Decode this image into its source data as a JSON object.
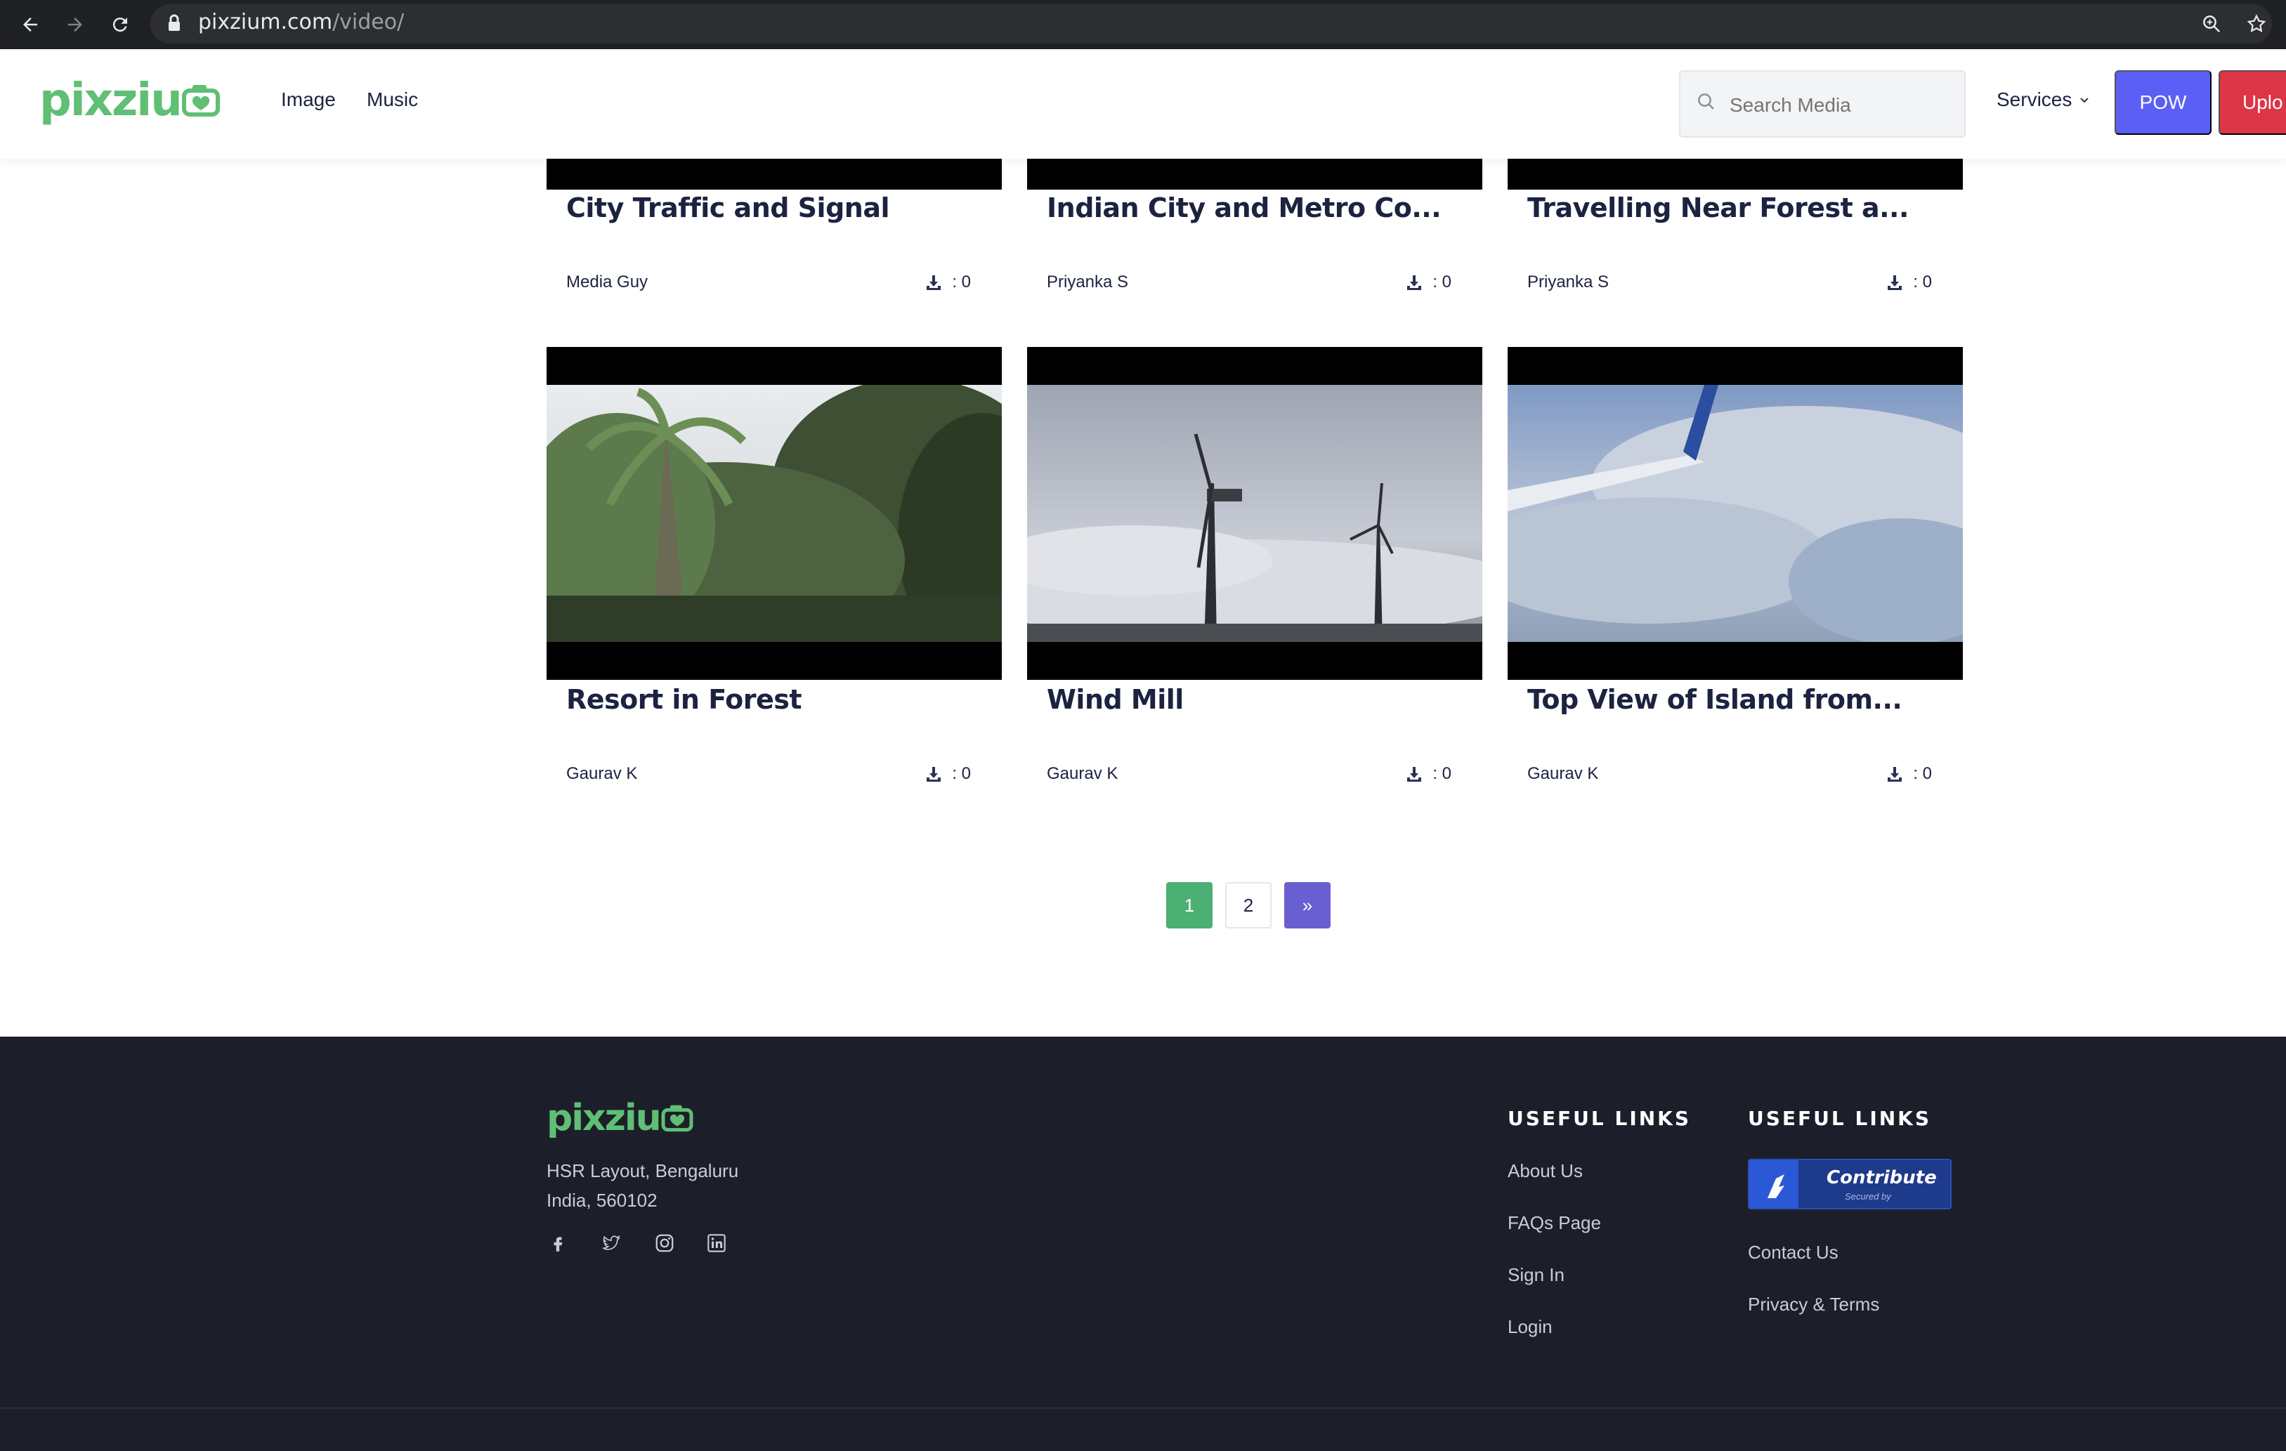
{
  "browser": {
    "url_domain": "pixzium.com",
    "url_path": "/video/"
  },
  "header": {
    "logo_text": "pixziu",
    "nav": [
      "Image",
      "Music"
    ],
    "search_placeholder": "Search Media",
    "services_label": "Services",
    "pow_label": "POW",
    "upload_label": "Uplo"
  },
  "cards": [
    {
      "title": "City Traffic and Signal",
      "author": "Media Guy",
      "downloads": ": 0"
    },
    {
      "title": "Indian City and Metro Co...",
      "author": "Priyanka S",
      "downloads": ": 0"
    },
    {
      "title": "Travelling Near Forest a...",
      "author": "Priyanka S",
      "downloads": ": 0"
    },
    {
      "title": "Resort in Forest",
      "author": "Gaurav K",
      "downloads": ": 0"
    },
    {
      "title": "Wind Mill",
      "author": "Gaurav K",
      "downloads": ": 0"
    },
    {
      "title": "Top View of Island from...",
      "author": "Gaurav K",
      "downloads": ": 0"
    }
  ],
  "pagination": {
    "pages": [
      "1",
      "2"
    ],
    "active_page": "1",
    "next_label": "»"
  },
  "footer": {
    "logo_text": "pixziu",
    "address_line1": "HSR Layout, Bengaluru",
    "address_line2": "India, 560102",
    "social_icons": [
      "facebook-icon",
      "twitter-icon",
      "instagram-icon",
      "linkedin-icon"
    ],
    "col1_heading": "USEFUL LINKS",
    "col1_links": [
      "About Us",
      "FAQs Page",
      "Sign In",
      "Login"
    ],
    "col2_heading": "USEFUL LINKS",
    "contribute_label": "Contribute",
    "contribute_sub": "Secured by",
    "col2_links": [
      "Contact Us",
      "Privacy & Terms"
    ]
  },
  "colors": {
    "brand_green": "#5fbf74",
    "pow_button": "#5b5ff5",
    "upload_button": "#dc3545",
    "pagination_active": "#4caf74",
    "pagination_next": "#6a5fd1",
    "footer_bg": "#1c1f2a"
  }
}
